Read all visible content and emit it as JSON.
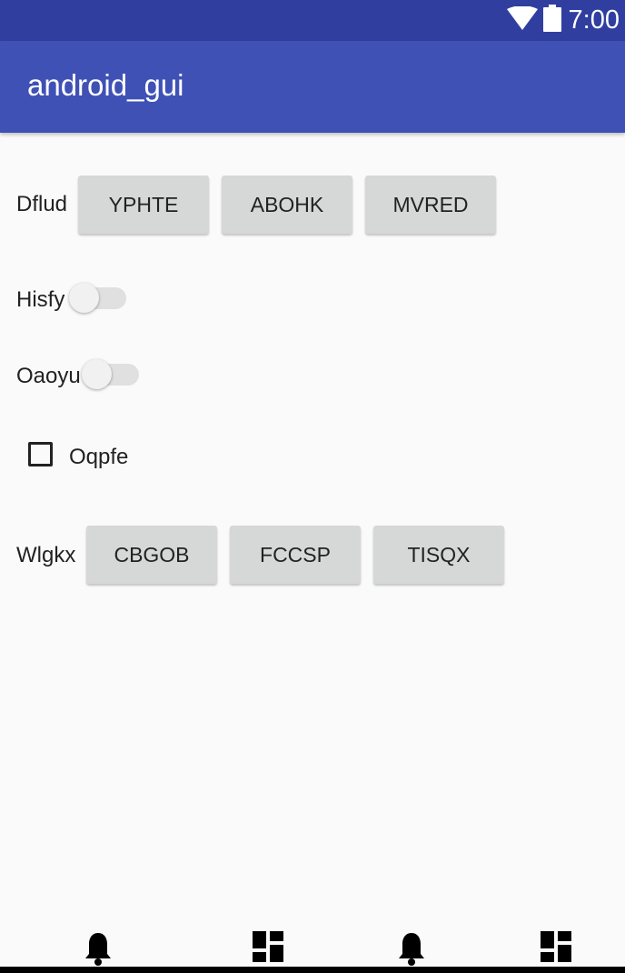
{
  "status_bar": {
    "time": "7:00",
    "icons": [
      "wifi-icon",
      "battery-icon"
    ]
  },
  "app_bar": {
    "title": "android_gui"
  },
  "rows": {
    "dflud": {
      "label": "Dflud",
      "buttons": [
        "YPHTE",
        "ABOHK",
        "MVRED"
      ]
    },
    "hisfy": {
      "label": "Hisfy",
      "checked": false
    },
    "oaoyu": {
      "label": "Oaoyu",
      "checked": false
    },
    "oqpfe": {
      "label": "Oqpfe",
      "checked": false
    },
    "wlgkx": {
      "label": "Wlgkx",
      "buttons": [
        "CBGOB",
        "FCCSP",
        "TISQX"
      ]
    }
  },
  "bottom_nav": {
    "icons": [
      "bell-icon",
      "dashboard-icon",
      "bell-icon",
      "dashboard-icon"
    ]
  },
  "colors": {
    "status_bar": "#303f9f",
    "app_bar": "#3f51b5",
    "button": "#d6d7d7",
    "background": "#fafafa"
  }
}
